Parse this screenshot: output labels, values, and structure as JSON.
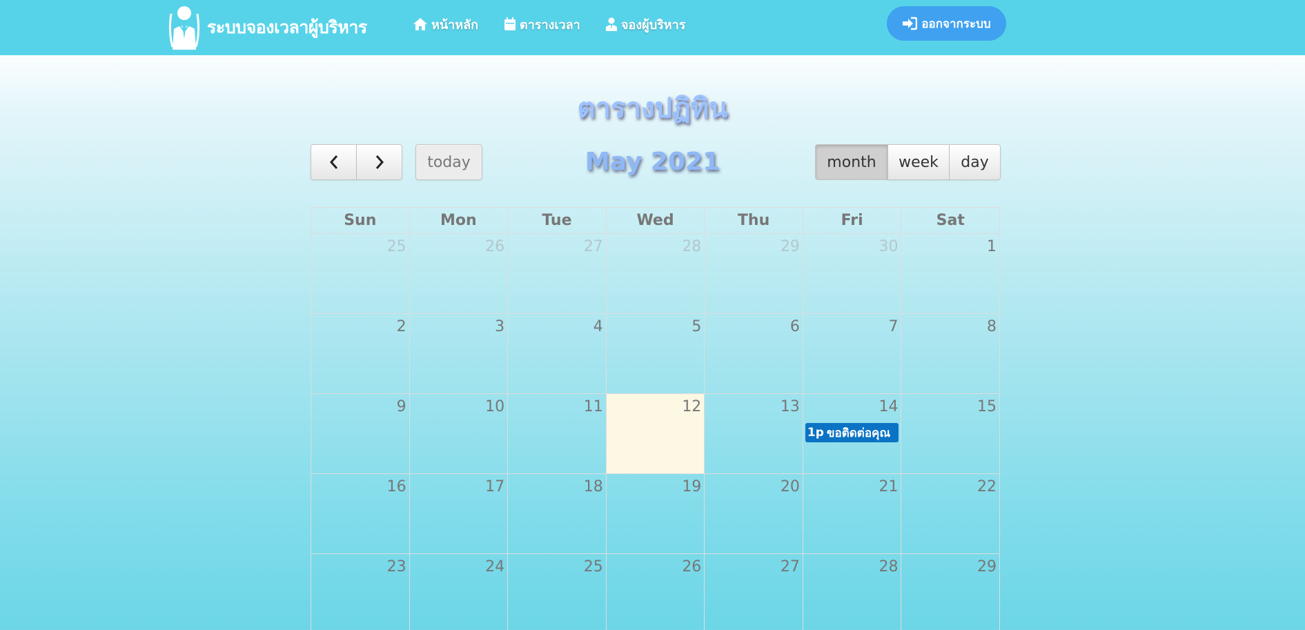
{
  "navbar": {
    "brand": "ระบบจองเวลาผู้บริหาร",
    "items": [
      {
        "label": "หน้าหลัก",
        "icon": "home-icon"
      },
      {
        "label": "ตารางเวลา",
        "icon": "calendar-icon"
      },
      {
        "label": "จองผู้บริหาร",
        "icon": "user-icon"
      }
    ],
    "logout_label": "ออกจากระบบ"
  },
  "page": {
    "title": "ตารางปฏิทิน"
  },
  "toolbar": {
    "prev_icon": "chevron-left-icon",
    "next_icon": "chevron-right-icon",
    "today_label": "today",
    "title": "May 2021",
    "views": [
      "month",
      "week",
      "day"
    ],
    "active_view": "month"
  },
  "calendar": {
    "weekdays": [
      "Sun",
      "Mon",
      "Tue",
      "Wed",
      "Thu",
      "Fri",
      "Sat"
    ],
    "weeks": [
      [
        {
          "d": "25",
          "o": true
        },
        {
          "d": "26",
          "o": true
        },
        {
          "d": "27",
          "o": true
        },
        {
          "d": "28",
          "o": true
        },
        {
          "d": "29",
          "o": true
        },
        {
          "d": "30",
          "o": true
        },
        {
          "d": "1"
        }
      ],
      [
        {
          "d": "2"
        },
        {
          "d": "3"
        },
        {
          "d": "4"
        },
        {
          "d": "5"
        },
        {
          "d": "6"
        },
        {
          "d": "7"
        },
        {
          "d": "8"
        }
      ],
      [
        {
          "d": "9"
        },
        {
          "d": "10"
        },
        {
          "d": "11"
        },
        {
          "d": "12",
          "today": true
        },
        {
          "d": "13"
        },
        {
          "d": "14"
        },
        {
          "d": "15"
        }
      ],
      [
        {
          "d": "16"
        },
        {
          "d": "17"
        },
        {
          "d": "18"
        },
        {
          "d": "19"
        },
        {
          "d": "20"
        },
        {
          "d": "21"
        },
        {
          "d": "22"
        }
      ],
      [
        {
          "d": "23"
        },
        {
          "d": "24"
        },
        {
          "d": "25"
        },
        {
          "d": "26"
        },
        {
          "d": "27"
        },
        {
          "d": "28"
        },
        {
          "d": "29"
        }
      ]
    ],
    "events": [
      {
        "date": "14",
        "time": "1p",
        "title": "ขอติดต่อคุณ"
      }
    ]
  }
}
